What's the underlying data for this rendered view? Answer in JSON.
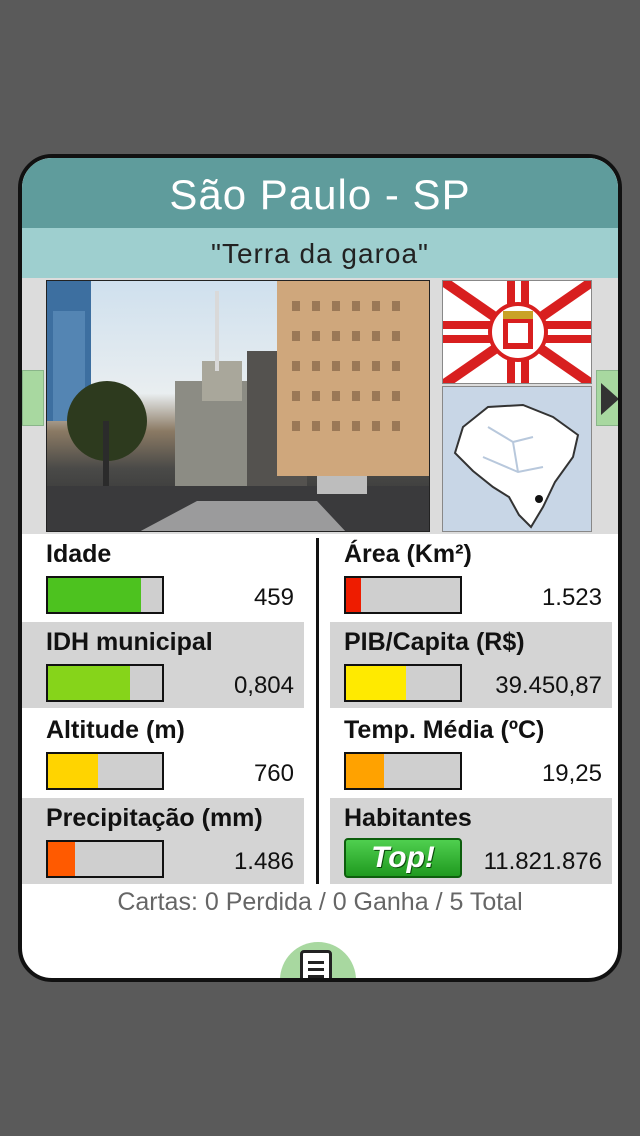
{
  "card": {
    "title": "São Paulo - SP",
    "subtitle": "\"Terra da garoa\""
  },
  "stats": [
    {
      "label": "Idade",
      "value": "459",
      "level": 0.82,
      "color": "#4dc21f"
    },
    {
      "label": "IDH municipal",
      "value": "0,804",
      "level": 0.72,
      "color": "#86d41a"
    },
    {
      "label": "Altitude (m)",
      "value": "760",
      "level": 0.44,
      "color": "#ffd400"
    },
    {
      "label": "Precipitação (mm)",
      "value": "1.486",
      "level": 0.24,
      "color": "#ff5a00"
    },
    {
      "label": "Área (Km²)",
      "value": "1.523",
      "level": 0.13,
      "color": "#ee1c00"
    },
    {
      "label": "PIB/Capita (R$)",
      "value": "39.450,87",
      "level": 0.53,
      "color": "#ffea00"
    },
    {
      "label": "Temp. Média (ºC)",
      "value": "19,25",
      "level": 0.33,
      "color": "#ffa200"
    },
    {
      "label": "Habitantes",
      "value": "11.821.876",
      "badge": "Top!"
    }
  ],
  "footer": {
    "cards_summary": "Cartas: 0 Perdida / 0 Ganha / 5 Total"
  },
  "icons": [
    "chevron-right-icon",
    "document-list-icon"
  ]
}
